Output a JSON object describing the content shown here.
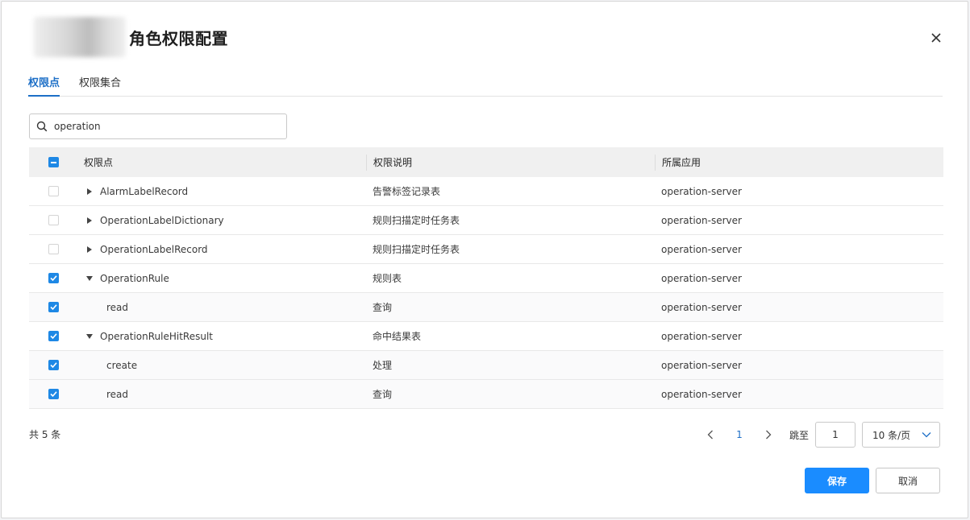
{
  "dialog": {
    "title": "角色权限配置"
  },
  "tabs": [
    {
      "label": "权限点",
      "active": true
    },
    {
      "label": "权限集合",
      "active": false
    }
  ],
  "search": {
    "value": "operation"
  },
  "table": {
    "headers": {
      "name": "权限点",
      "desc": "权限说明",
      "app": "所属应用"
    },
    "header_checkbox": "partial",
    "rows": [
      {
        "name": "AlarmLabelRecord",
        "desc": "告警标签记录表",
        "app": "operation-server",
        "checked": false,
        "level": 0,
        "expand": "collapsed"
      },
      {
        "name": "OperationLabelDictionary",
        "desc": "规则扫描定时任务表",
        "app": "operation-server",
        "checked": false,
        "level": 0,
        "expand": "collapsed"
      },
      {
        "name": "OperationLabelRecord",
        "desc": "规则扫描定时任务表",
        "app": "operation-server",
        "checked": false,
        "level": 0,
        "expand": "collapsed"
      },
      {
        "name": "OperationRule",
        "desc": "规则表",
        "app": "operation-server",
        "checked": true,
        "level": 0,
        "expand": "expanded"
      },
      {
        "name": "read",
        "desc": "查询",
        "app": "operation-server",
        "checked": true,
        "level": 1,
        "expand": "none"
      },
      {
        "name": "OperationRuleHitResult",
        "desc": "命中结果表",
        "app": "operation-server",
        "checked": true,
        "level": 0,
        "expand": "expanded"
      },
      {
        "name": "create",
        "desc": "处理",
        "app": "operation-server",
        "checked": true,
        "level": 1,
        "expand": "none"
      },
      {
        "name": "read",
        "desc": "查询",
        "app": "operation-server",
        "checked": true,
        "level": 1,
        "expand": "none"
      }
    ]
  },
  "pagination": {
    "total_text": "共 5 条",
    "current_page": "1",
    "jump_label": "跳至",
    "jump_value": "1",
    "page_size": "10 条/页"
  },
  "footer": {
    "save_label": "保存",
    "cancel_label": "取消"
  },
  "colors": {
    "accent": "#1d6fc7",
    "primary_button": "#1a8cff",
    "checkbox": "#1e88e5"
  }
}
